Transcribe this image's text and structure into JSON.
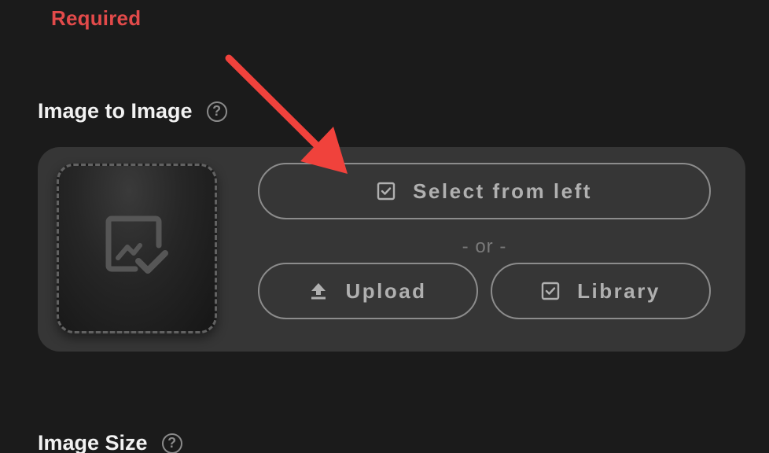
{
  "required_label": "Required",
  "image_to_image": {
    "title": "Image to Image",
    "help_glyph": "?",
    "select_label": "Select from left",
    "or_text": "- or -",
    "upload_label": "Upload",
    "library_label": "Library"
  },
  "image_size": {
    "title": "Image Size",
    "help_glyph": "?"
  },
  "colors": {
    "background": "#1b1b1b",
    "panel": "#363636",
    "required": "#e24a4a",
    "annotation_arrow": "#f0423c",
    "button_border": "#8c8c8c",
    "button_text": "#b0b0b0"
  },
  "icons": {
    "dropzone": "image-check-icon",
    "select": "checkbox-icon",
    "upload": "upload-icon",
    "library": "checkbox-icon"
  }
}
